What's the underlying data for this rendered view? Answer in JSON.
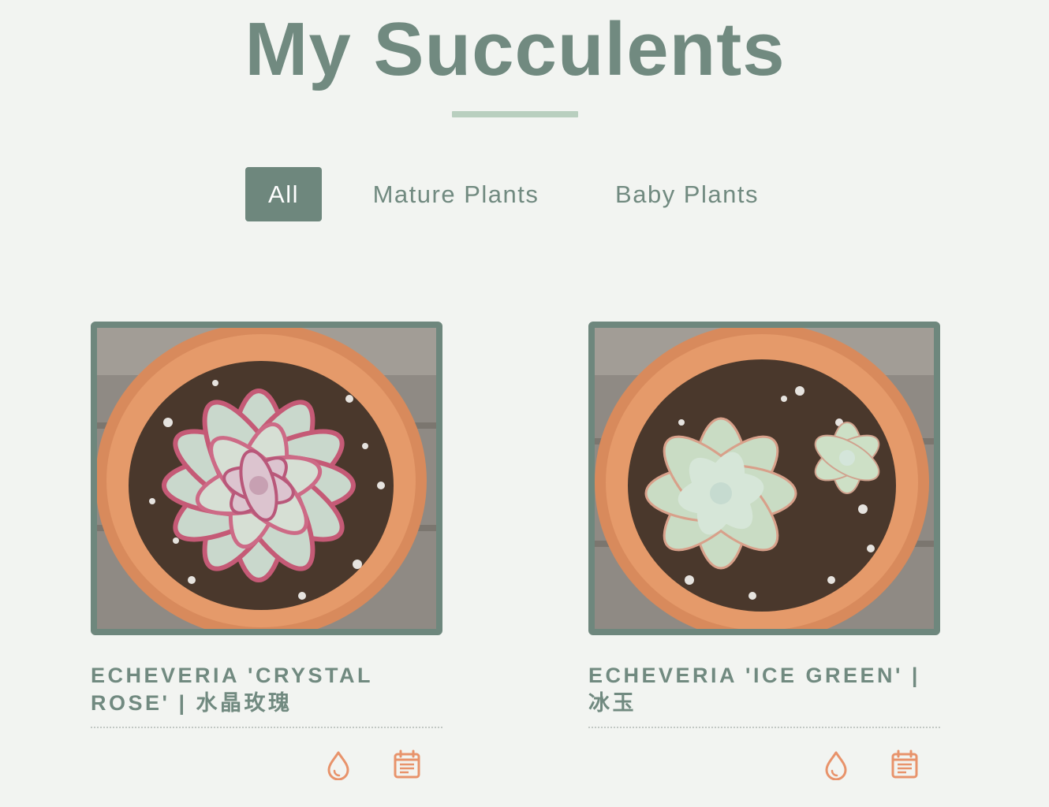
{
  "header": {
    "title": "My Succulents"
  },
  "filters": [
    {
      "label": "All",
      "active": true
    },
    {
      "label": "Mature Plants",
      "active": false
    },
    {
      "label": "Baby Plants",
      "active": false
    }
  ],
  "plants": [
    {
      "name": "Echeveria 'Crystal Rose' | 水晶玫瑰",
      "image_icon": "succulent-photo-rose",
      "actions": [
        "water-drop-icon",
        "calendar-icon"
      ]
    },
    {
      "name": "Echeveria 'Ice Green' | 冰玉",
      "image_icon": "succulent-photo-green",
      "actions": [
        "water-drop-icon",
        "calendar-icon"
      ]
    }
  ],
  "colors": {
    "primary": "#6e877d",
    "accent": "#e8936b",
    "background": "#f2f4f1",
    "underline": "#b9cfbf"
  }
}
